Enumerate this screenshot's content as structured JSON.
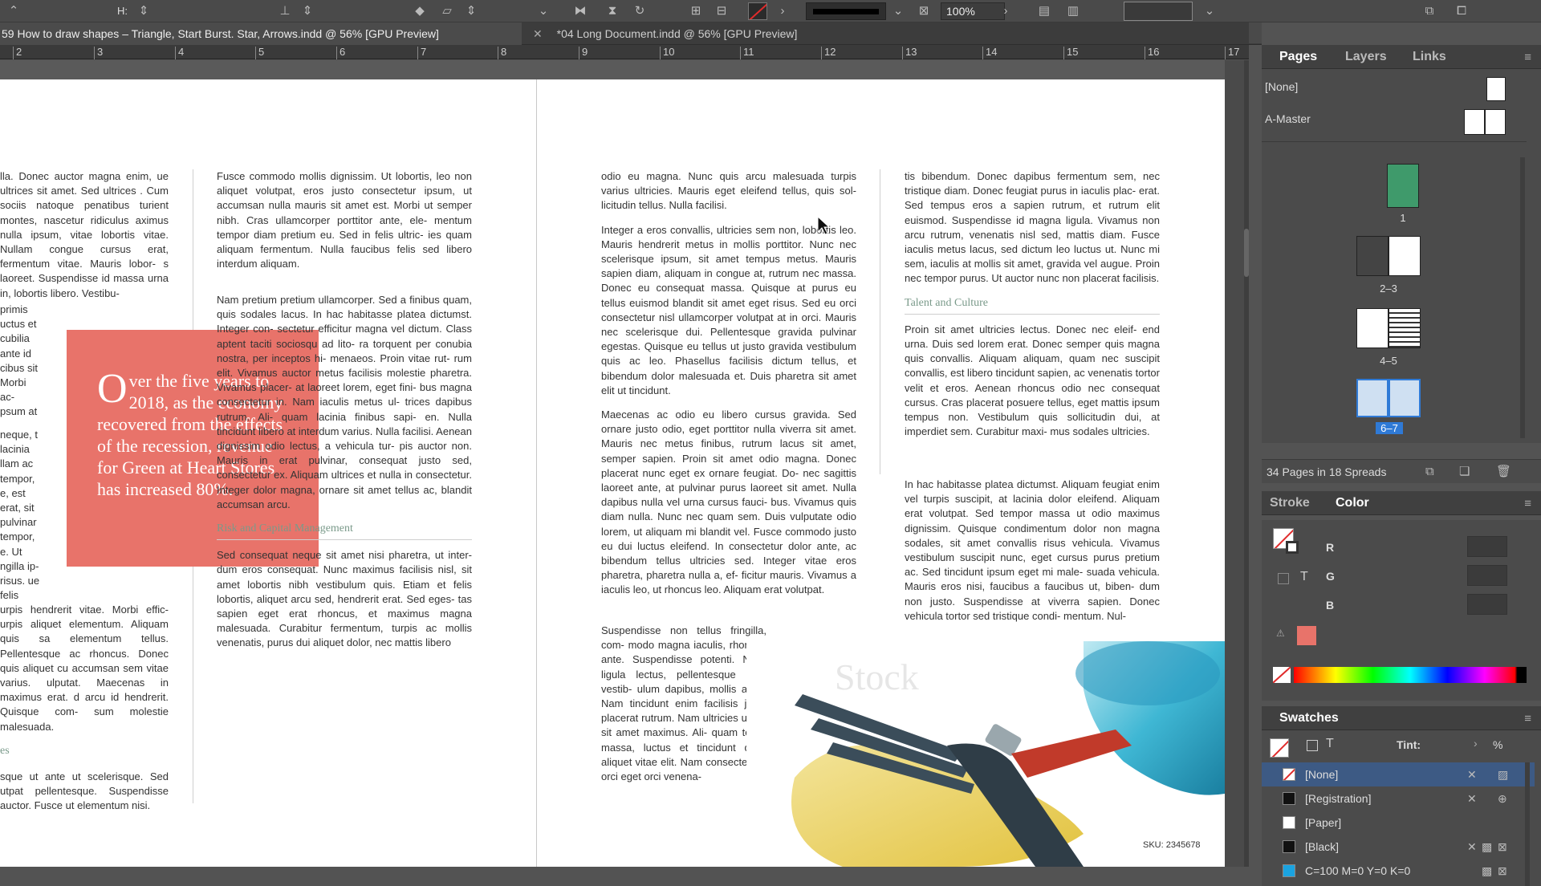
{
  "control_bar": {
    "h_label": "H:",
    "zoom_value": "100%"
  },
  "tabs": [
    {
      "label": "59 How to draw shapes – Triangle, Start Burst. Star, Arrows.indd @ 56% [GPU Preview]"
    },
    {
      "label": "*04 Long Document.indd @ 56% [GPU Preview]"
    }
  ],
  "ruler": [
    "2",
    "3",
    "4",
    "5",
    "6",
    "7",
    "8",
    "9",
    "10",
    "11",
    "12",
    "13",
    "14",
    "15",
    "16",
    "17"
  ],
  "document": {
    "col1": [
      "lla. Donec auctor magna enim, ue ultrices sit amet. Sed ultrices . Cum sociis natoque penatibus turient montes, nascetur ridiculus aximus nulla ipsum, vitae lobortis vitae. Nullam congue cursus erat, fermentum vitae. Mauris lobor- s laoreet. Suspendisse id massa urna in, lobortis libero. Vestibu-",
      "primis uctus et cubilia ante id cibus sit Morbi ac- psum at",
      "neque, t lacinia llam ac tempor, e, est erat, sit pulvinar tempor, e. Ut ngilla ip- risus. ue felis",
      "urpis hendrerit vitae. Morbi effic- urpis aliquet elementum. Aliquam quis sa elementum tellus. Pellentesque ac rhoncus. Donec quis aliquet cu accumsan sem vitae varius. ulputat. Maecenas in maximus erat. d arcu id hendrerit. Quisque com- sum molestie malesuada.",
      "sque ut ante ut scelerisque. Sed utpat pellentesque. Suspendisse auctor. Fusce ut elementum nisi."
    ],
    "col1_heading": "es",
    "col2": [
      "Fusce commodo mollis dignissim. Ut lobortis, leo non aliquet volutpat, eros justo consectetur ipsum, ut accumsan nulla mauris sit amet est. Morbi ut semper nibh. Cras ullamcorper porttitor ante, ele- mentum tempor diam pretium eu. Sed in felis ultric- ies quam aliquam fermentum. Nulla faucibus felis sed libero interdum aliquam.",
      "Nam pretium pretium ullamcorper. Sed a finibus quam, quis sodales lacus. In hac habitasse platea dictumst. Integer con- sectetur efficitur magna vel dictum. Class aptent taciti sociosqu ad lito- ra torquent per conubia nostra, per inceptos hi- menaeos. Proin vitae rut- rum elit. Vivamus auctor metus facilisis molestie pharetra. Vivamus placer- at laoreet lorem, eget fini- bus magna consectetur in. Nam iaculis metus ul- trices dapibus rutrum. Ali- quam lacinia finibus sapi- en. Nulla tincidunt libero at interdum varius. Nulla facilisi. Aenean dignissim odio lectus, a vehicula tur- pis auctor non. Mauris in erat pulvinar, consequat justo sed, consectetur ex. Aliquam ultrices et nulla in consectetur. Integer dolor magna, ornare sit amet tellus ac, blandit accumsan arcu.",
      "Sed consequat neque sit amet nisi pharetra, ut inter- dum eros consequat. Nunc maximus facilisis nisl, sit amet lobortis nibh vestibulum quis. Etiam et felis lobortis, aliquet arcu sed, hendrerit erat. Sed eges- tas sapien eget erat rhoncus, et maximus magna malesuada. Curabitur fermentum, turpis ac mollis venenatis, purus dui aliquet dolor, nec mattis libero"
    ],
    "col2_heading": "Risk and Capital Management",
    "pullquote_dropcap": "O",
    "pullquote": "ver the five years to 2018, as the economy recovered from the effects of the recession, revenue for Green at Heart Stores has increased 80%.",
    "col3": [
      "odio eu magna. Nunc quis arcu malesuada turpis varius ultricies. Mauris eget eleifend tellus, quis sol- licitudin tellus. Nulla facilisi.",
      "Integer a eros convallis, ultricies sem non, lobortis leo. Mauris hendrerit metus in mollis porttitor. Nunc nec scelerisque ipsum, sit amet tempus metus. Mauris sapien diam, aliquam in congue at, rutrum nec massa. Donec eu consequat massa. Quisque at purus eu tellus euismod blandit sit amet eget risus. Sed eu orci consectetur nisl ullamcorper volutpat at in orci. Mauris nec scelerisque dui. Pellentesque gravida pulvinar egestas. Quisque eu tellus ut justo gravida vestibulum quis ac leo. Phasellus facilisis dictum tellus, et bibendum dolor malesuada et. Duis pharetra sit amet elit ut tincidunt.",
      "Maecenas ac odio eu libero cursus gravida. Sed ornare justo odio, eget porttitor nulla viverra sit amet. Mauris nec metus finibus, rutrum lacus sit amet, semper sapien. Proin sit amet odio magna. Donec placerat nunc eget ex ornare feugiat. Do- nec sagittis laoreet ante, at pulvinar purus laoreet sit amet. Nulla dapibus nulla vel urna cursus fauci- bus. Vivamus quis diam nulla. Nunc nec quam sem. Duis vulputate odio lorem, ut aliquam mi blandit vel. Fusce commodo justo eu dui luctus eleifend. In consectetur dolor ante, ac bibendum tellus ultricies sed. Integer vitae eros pharetra, pharetra nulla a, ef- ficitur mauris. Vivamus a iaculis leo, ut rhoncus leo. Aliquam erat volutpat.",
      "Suspendisse non tellus fringilla, com- modo magna iaculis, rhoncus ante. Suspendisse potenti. Nulla ligula lectus, pellentesque eget vestib- ulum dapibus, mollis a mi. Nam tincidunt enim facilisis justo placerat rutrum. Nam ultricies ut elit sit amet maximus. Ali- quam tellus massa, luctus et tincidunt quis, aliquet vitae elit. Nam consecte- tur orci eget orci venena-"
    ],
    "col4": [
      "tis bibendum. Donec dapibus fermentum sem, nec tristique diam. Donec feugiat purus in iaculis plac- erat. Sed tempus eros a sapien rutrum, et rutrum elit euismod. Suspendisse id magna ligula. Vivamus non arcu rutrum, venenatis nisl sed, mattis diam. Fusce iaculis metus lacus, sed dictum leo luctus ut. Nunc mi sem, iaculis at mollis sit amet, gravida vel augue. Proin nec tempor purus. Ut auctor nunc non placerat facilisis.",
      "Proin sit amet ultricies lectus. Donec nec eleif- end urna. Duis sed lorem erat. Donec semper quis magna quis convallis. Aliquam aliquam, quam nec suscipit convallis, est libero tincidunt sapien, ac venenatis tortor velit et eros. Aenean rhoncus odio nec consequat cursus. Cras placerat posuere tellus, eget mattis ipsum tempus non. Vestibulum quis sollicitudin dui, at imperdiet sem. Curabitur maxi- mus sodales ultricies.",
      "In hac habitasse platea dictumst. Aliquam feugiat enim vel turpis suscipit, at lacinia dolor eleifend. Aliquam erat volutpat. Sed tempor massa ut odio maximus dignissim. Quisque condimentum dolor non magna sodales, sit amet convallis risus vehicula. Vivamus vestibulum suscipit nunc, eget cursus purus pretium ac. Sed tincidunt ipsum eget mi male- suada vehicula. Mauris eros nisi, faucibus a faucibus ut, biben- dum non justo. Suspendisse at viverra sapien. Donec vehicula tortor sed tristique condi- mentum. Nul-"
    ],
    "col4_heading": "Talent and Culture",
    "sku": "SKU: 2345678"
  },
  "pages_panel": {
    "tabs": [
      "Pages",
      "Layers",
      "Links"
    ],
    "masters": [
      "[None]",
      "A-Master"
    ],
    "page_labels": [
      "1",
      "2–3",
      "4–5",
      "6–7"
    ],
    "footer": "34 Pages in 18 Spreads"
  },
  "color_panel": {
    "tabs": [
      "Stroke",
      "Color"
    ],
    "channels": [
      "R",
      "G",
      "B"
    ],
    "accent": "#e8736a"
  },
  "swatches_panel": {
    "title": "Swatches",
    "tint_label": "Tint:",
    "tint_unit": "%",
    "items": [
      {
        "name": "[None]",
        "color": "#ffffff"
      },
      {
        "name": "[Registration]",
        "color": "#111111"
      },
      {
        "name": "[Paper]",
        "color": "#ffffff"
      },
      {
        "name": "[Black]",
        "color": "#111111"
      },
      {
        "name": "C=100 M=0 Y=0 K=0",
        "color": "#1aa3e0"
      }
    ]
  }
}
